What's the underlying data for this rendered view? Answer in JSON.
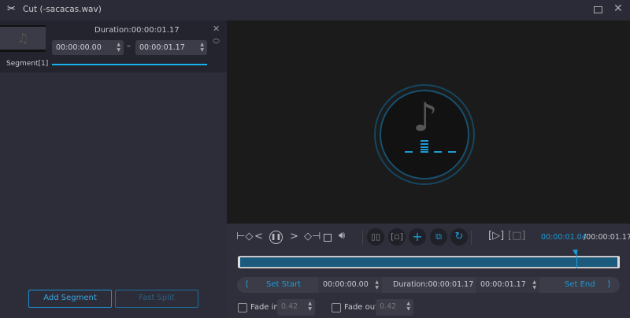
{
  "window": {
    "title": "Cut (-sacacas.wav)"
  },
  "segment": {
    "label": "Segment[1]",
    "duration": "Duration:00:00:01.17",
    "start": "00:00:00.00",
    "end": "00:00:01.17",
    "dash": "–"
  },
  "left_buttons": {
    "add_segment": "Add Segment",
    "fast_split": "Fast Split"
  },
  "player": {
    "current_time": "00:00:01.04",
    "total_time": "/00:00:01.17",
    "progress": 0.89
  },
  "trim": {
    "open_bracket": "[",
    "set_start": "Set Start",
    "start": "00:00:00.00",
    "duration": "Duration:00:00:01.17",
    "end": "00:00:01.17",
    "set_end": "Set End",
    "close_bracket": "]"
  },
  "fade": {
    "fade_in_label": "Fade in",
    "fade_in_value": "0.42",
    "fade_out_label": "Fade out",
    "fade_out_value": "0.42"
  },
  "colors": {
    "accent": "#1e9ad6",
    "timeline": "#1b5a7c"
  }
}
